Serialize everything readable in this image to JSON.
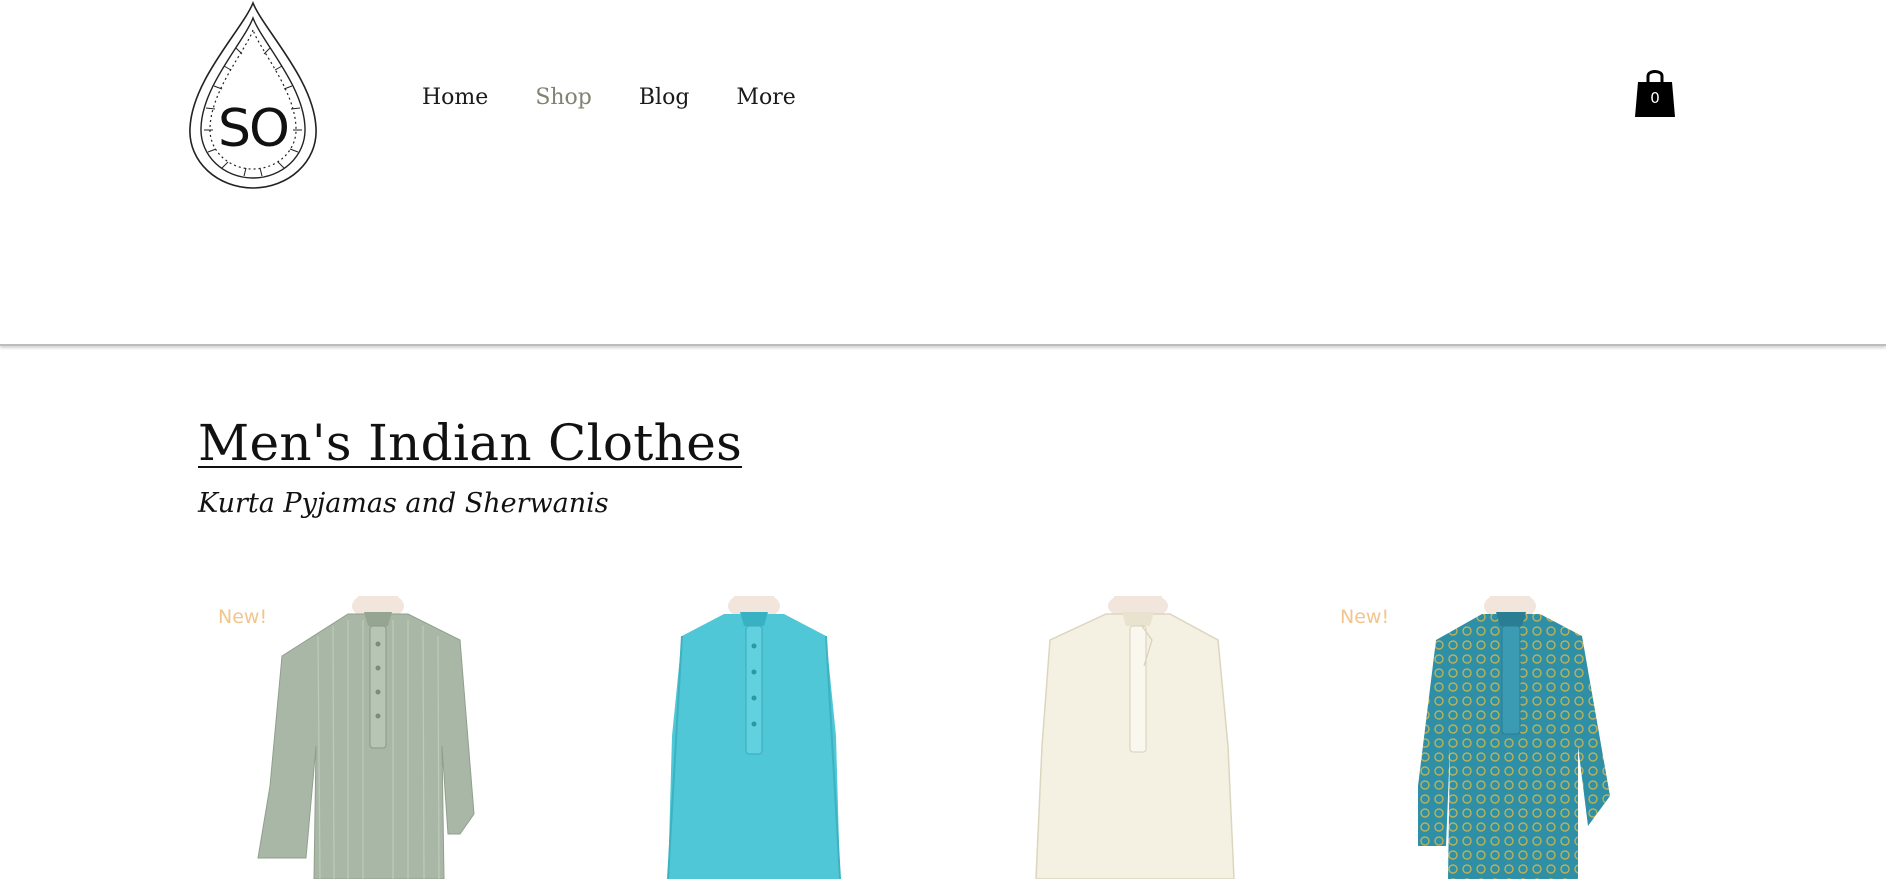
{
  "header": {
    "logo_text": "SO",
    "nav": [
      {
        "label": "Home",
        "active": false
      },
      {
        "label": "Shop",
        "active": true
      },
      {
        "label": "Blog",
        "active": false
      },
      {
        "label": "More",
        "active": false
      }
    ],
    "cart_count": "0"
  },
  "main": {
    "title": "Men's Indian Clothes",
    "subtitle": "Kurta Pyjamas and Sherwanis",
    "products": [
      {
        "ribbon": "New!",
        "garment_color": "#a9b8a6",
        "image": "sage-green-kurta"
      },
      {
        "ribbon": "",
        "garment_color": "#4fc7d6",
        "image": "turquoise-kurta"
      },
      {
        "ribbon": "",
        "garment_color": "#f4f0e2",
        "image": "cream-kurta"
      },
      {
        "ribbon": "New!",
        "garment_color": "#2f8fa6",
        "image": "teal-gold-brocade-kurta"
      }
    ]
  },
  "colors": {
    "nav_active": "#7f8370",
    "ribbon": "#f2c58d",
    "text": "#111111"
  }
}
